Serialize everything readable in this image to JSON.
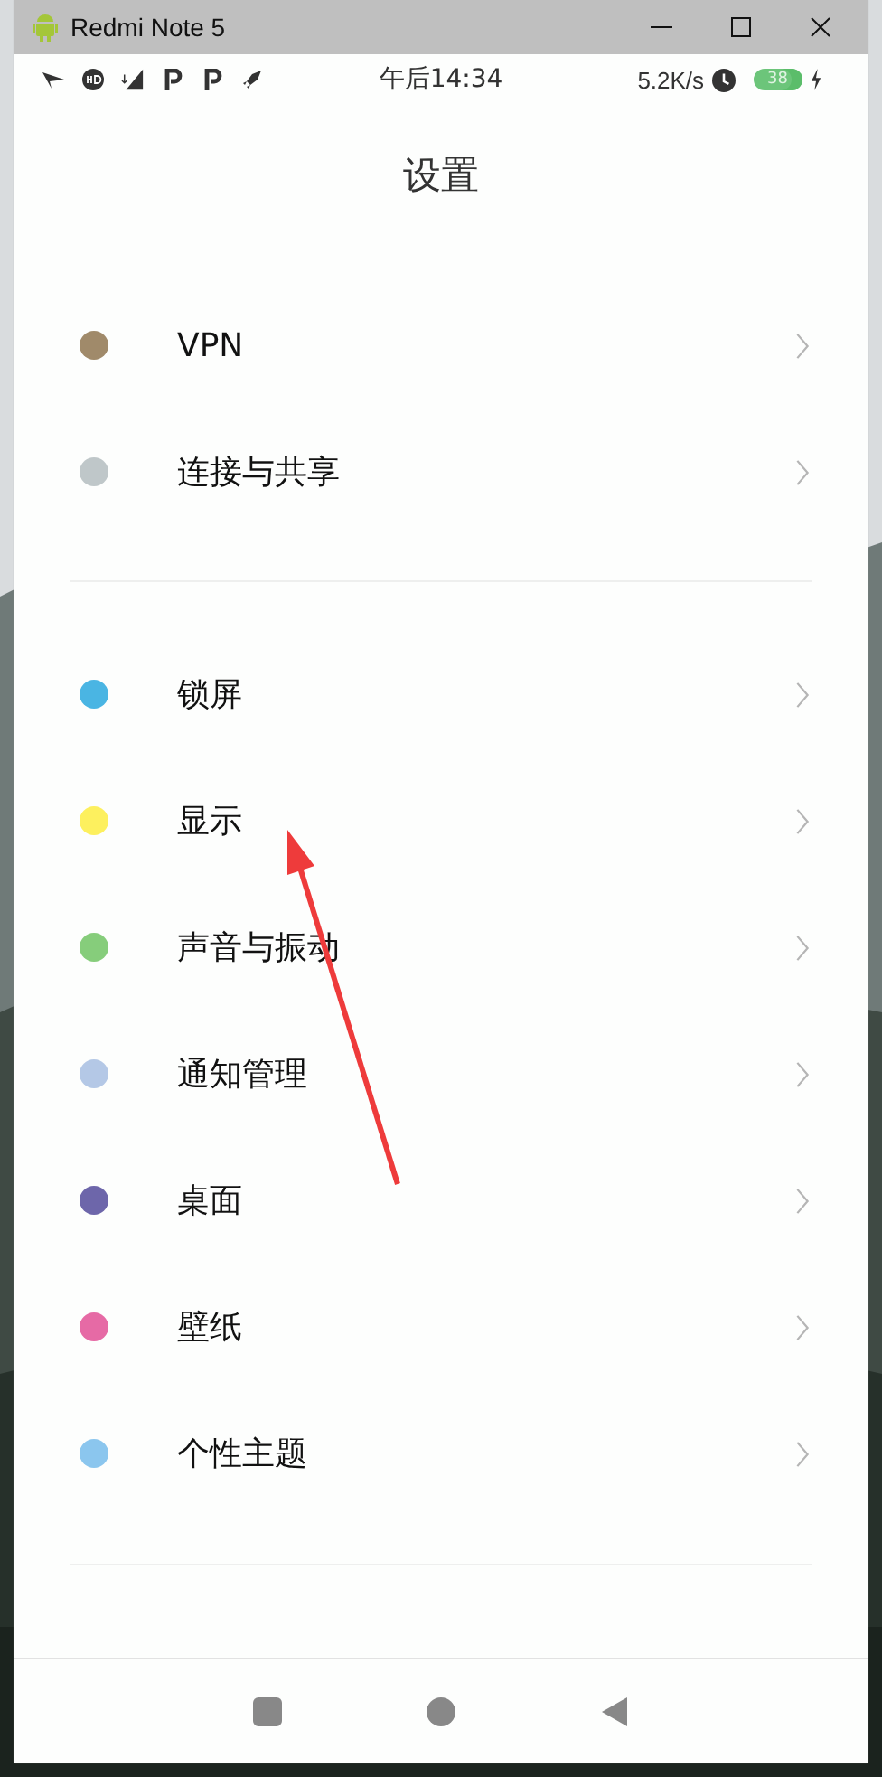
{
  "window": {
    "title": "Redmi Note 5"
  },
  "status_bar": {
    "time": "午后14:34",
    "speed": "5.2K/s",
    "battery": "38"
  },
  "header": {
    "title": "设置"
  },
  "groups": [
    {
      "items": [
        {
          "label": "VPN",
          "color": "#a08a6a"
        },
        {
          "label": "连接与共享",
          "color": "#bfc7c9"
        }
      ]
    },
    {
      "items": [
        {
          "label": "锁屏",
          "color": "#4ab5e3"
        },
        {
          "label": "显示",
          "color": "#fdf05e"
        },
        {
          "label": "声音与振动",
          "color": "#86cd7b"
        },
        {
          "label": "通知管理",
          "color": "#b4c8e6"
        },
        {
          "label": "桌面",
          "color": "#6d66aa"
        },
        {
          "label": "壁纸",
          "color": "#e66aa5"
        },
        {
          "label": "个性主题",
          "color": "#8bc6ee"
        }
      ]
    }
  ]
}
